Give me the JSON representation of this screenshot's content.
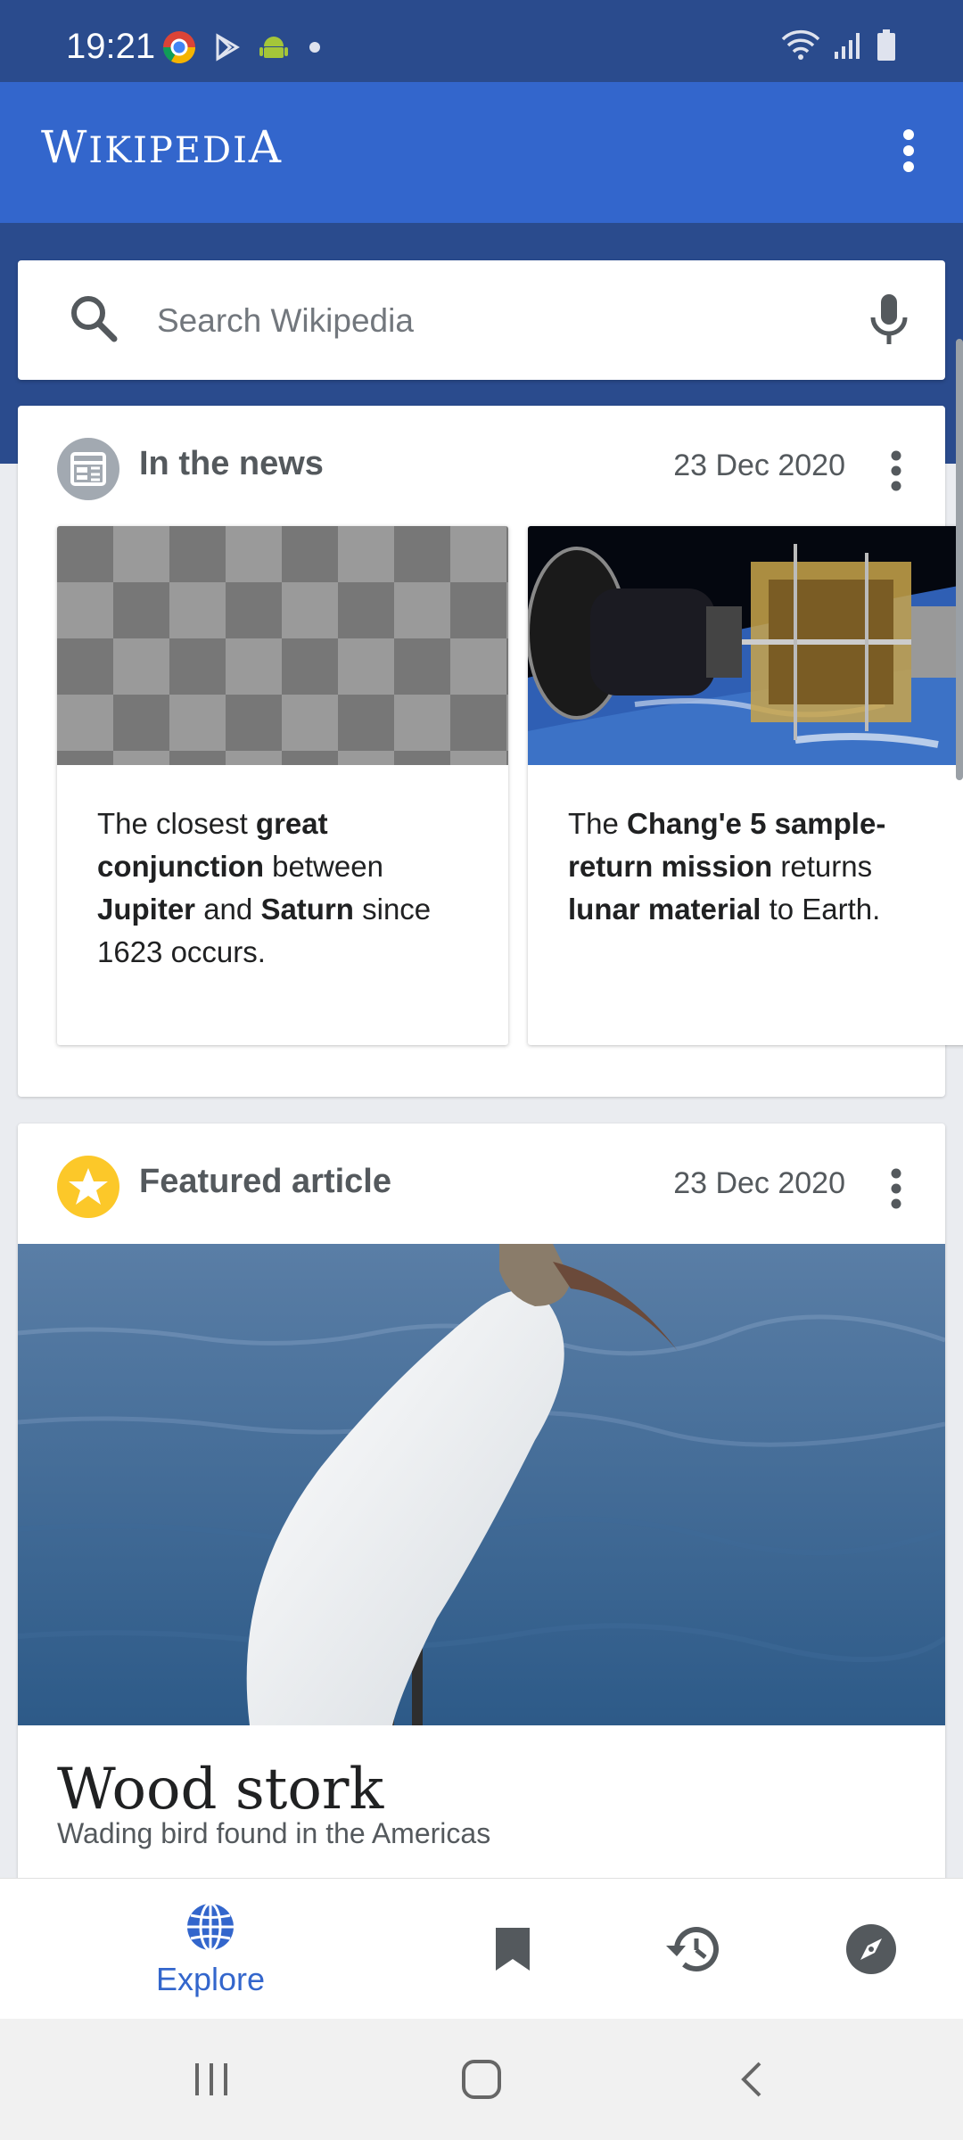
{
  "status_bar": {
    "time": "19:21",
    "icons": [
      "chrome-icon",
      "play-store-icon",
      "android-icon",
      "dot-icon",
      "wifi-icon",
      "signal-icon",
      "battery-icon"
    ]
  },
  "app_bar": {
    "title_first": "W",
    "title_rest": "IKIPEDI",
    "title_last": "A",
    "menu_icon": "more-vert-icon"
  },
  "search": {
    "placeholder": "Search Wikipedia",
    "search_icon": "search-icon",
    "mic_icon": "mic-icon"
  },
  "news_card": {
    "title": "In the news",
    "date": "23 Dec 2020",
    "items": [
      {
        "parts": [
          {
            "text": "The closest ",
            "bold": false
          },
          {
            "text": "great conjunction",
            "bold": true
          },
          {
            "text": " between ",
            "bold": false
          },
          {
            "text": "Jupiter",
            "bold": true
          },
          {
            "text": " and ",
            "bold": false
          },
          {
            "text": "Saturn",
            "bold": true
          },
          {
            "text": " since 1623 occurs.",
            "bold": false
          }
        ]
      },
      {
        "parts": [
          {
            "text": "The ",
            "bold": false
          },
          {
            "text": "Chang'e 5 sample-return mission",
            "bold": true
          },
          {
            "text": " returns ",
            "bold": false
          },
          {
            "text": "lunar material",
            "bold": true
          },
          {
            "text": " to Earth.",
            "bold": false
          }
        ]
      }
    ]
  },
  "featured_card": {
    "title": "Featured article",
    "date": "23 Dec 2020",
    "article_title": "Wood stork",
    "article_description": "Wading bird found in the Americas"
  },
  "bottom_nav": {
    "explore_label": "Explore",
    "items": [
      "explore-icon",
      "saved-icon",
      "history-icon",
      "suggested-edits-icon"
    ]
  },
  "colors": {
    "status_bar": "#2a4b8d",
    "app_bar": "#3366cc",
    "accent": "#3366cc",
    "featured_icon": "#fcc829"
  }
}
